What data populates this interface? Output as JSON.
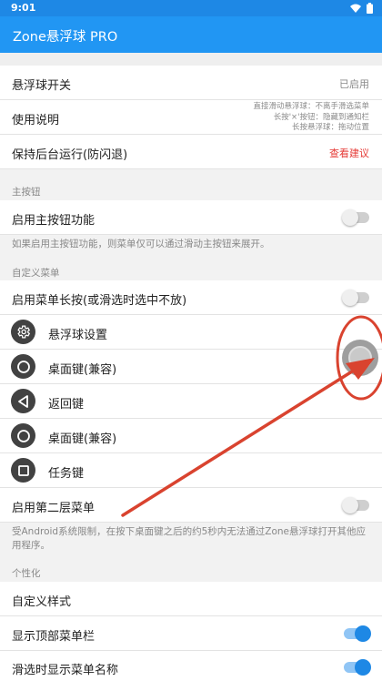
{
  "status": {
    "time": "9:01"
  },
  "app": {
    "title": "Zone悬浮球 PRO"
  },
  "settings": {
    "float_toggle": {
      "label": "悬浮球开关",
      "value": "已启用"
    },
    "instructions": {
      "label": "使用说明",
      "help": [
        "直接滑动悬浮球：不离手滑选菜单",
        "长按'×'按钮：隐藏到通知栏",
        "长按悬浮球：拖动位置"
      ]
    },
    "keep_alive": {
      "label": "保持后台运行(防闪退)",
      "action": "查看建议"
    }
  },
  "main_button": {
    "section": "主按钮",
    "enable": {
      "label": "启用主按钮功能",
      "on": false
    },
    "note": "如果启用主按钮功能，则菜单仅可以通过滑动主按钮来展开。"
  },
  "custom_menu": {
    "section": "自定义菜单",
    "long_press": {
      "label": "启用菜单长按(或滑选时选中不放)",
      "on": false
    },
    "items": [
      {
        "label": "悬浮球设置",
        "icon": "gear-icon"
      },
      {
        "label": "桌面键(兼容)",
        "icon": "circle-home-icon"
      },
      {
        "label": "返回键",
        "icon": "triangle-back-icon"
      },
      {
        "label": "桌面键(兼容)",
        "icon": "circle-home-icon"
      },
      {
        "label": "任务键",
        "icon": "square-recents-icon"
      }
    ],
    "second_layer": {
      "label": "启用第二层菜单",
      "on": false
    },
    "note": "受Android系统限制，在按下桌面键之后的约5秒内无法通过Zone悬浮球打开其他应用程序。"
  },
  "personalize": {
    "section": "个性化",
    "custom_style": {
      "label": "自定义样式"
    },
    "show_top_bar": {
      "label": "显示顶部菜单栏",
      "on": true
    },
    "show_names": {
      "label": "滑选时显示菜单名称",
      "on": true
    }
  },
  "colors": {
    "primary": "#2196f3",
    "status_bar": "#1e88e5",
    "accent_red": "#e53935",
    "annotation_red": "#d9432f"
  }
}
